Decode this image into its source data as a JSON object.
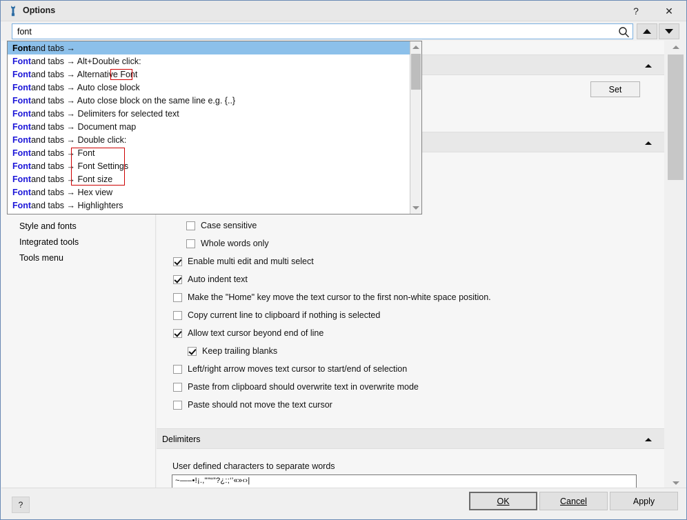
{
  "window": {
    "title": "Options",
    "icon": "wrench-icon",
    "help_label": "?",
    "close_label": "✕"
  },
  "search": {
    "value": "font",
    "placeholder": "",
    "magnifier_icon": "search-icon",
    "prev_label": "▲",
    "next_label": "▼"
  },
  "dropdown": {
    "items": [
      {
        "key": "Font",
        "rest": " and tabs →",
        "selected": true
      },
      {
        "key": "Font",
        "rest": " and tabs → Alt+Double click:",
        "selected": false
      },
      {
        "key": "Font",
        "rest": " and tabs → Alternative Font",
        "selected": false
      },
      {
        "key": "Font",
        "rest": " and tabs → Auto close block",
        "selected": false
      },
      {
        "key": "Font",
        "rest": " and tabs → Auto close block on the same line e.g. {..}",
        "selected": false
      },
      {
        "key": "Font",
        "rest": " and tabs → Delimiters for selected text",
        "selected": false
      },
      {
        "key": "Font",
        "rest": " and tabs → Document map",
        "selected": false
      },
      {
        "key": "Font",
        "rest": " and tabs → Double click:",
        "selected": false
      },
      {
        "key": "Font",
        "rest": " and tabs → Font",
        "selected": false
      },
      {
        "key": "Font",
        "rest": " and tabs → Font Settings",
        "selected": false
      },
      {
        "key": "Font",
        "rest": " and tabs → Font size",
        "selected": false
      },
      {
        "key": "Font",
        "rest": " and tabs → Hex view",
        "selected": false
      },
      {
        "key": "Font",
        "rest": " and tabs → Highlighters",
        "selected": false
      }
    ],
    "scrollbar": {
      "up_icon": "chevron-up-icon",
      "down_icon": "chevron-down-icon"
    }
  },
  "sidebar": {
    "items": [
      {
        "label": "Style and fonts"
      },
      {
        "label": "Integrated tools"
      },
      {
        "label": "Tools menu"
      }
    ]
  },
  "main": {
    "sections": [
      {
        "label": "",
        "collapse_icon": "collapse-up-icon"
      },
      {
        "label": "",
        "collapse_icon": "collapse-up-icon"
      },
      {
        "label": "Delimiters",
        "collapse_icon": "collapse-up-icon"
      }
    ],
    "set_button": "Set",
    "checkboxes": [
      {
        "label": "Case sensitive",
        "checked": false
      },
      {
        "label": "Whole words only",
        "checked": false
      },
      {
        "label": "Enable multi edit and multi select",
        "checked": true
      },
      {
        "label": "Auto indent text",
        "checked": true
      },
      {
        "label": "Make the \"Home\" key move the text cursor to the first non-white space position.",
        "checked": false
      },
      {
        "label": "Copy current line to clipboard if nothing is selected",
        "checked": false
      },
      {
        "label": "Allow text cursor beyond end of line",
        "checked": true
      },
      {
        "label": "Keep trailing blanks",
        "checked": true
      },
      {
        "label": "Left/right arrow moves text cursor to start/end of selection",
        "checked": false
      },
      {
        "label": "Paste from clipboard should overwrite text in overwrite mode",
        "checked": false
      },
      {
        "label": "Paste should not move the text cursor",
        "checked": false
      }
    ],
    "delimiters": {
      "label": "User defined characters to separate words",
      "value": "~—–•!¡.,\"\"“”?¿:;‘’«»‹›|"
    },
    "scrollbar": {
      "up_icon": "chevron-up-icon",
      "down_icon": "chevron-down-icon"
    }
  },
  "footer": {
    "help_label": "?",
    "ok_label": "OK",
    "ok_accel": "O",
    "cancel_label": "Cancel",
    "cancel_accel": "C",
    "apply_label": "Apply"
  },
  "colors": {
    "selection": "#8cc0ea",
    "key_text": "#1c16d8",
    "match_box": "#cc0000",
    "window_bg": "#f0f0f0",
    "pane_bg": "#f6f6f6",
    "section_bg": "#e8e8e8"
  }
}
